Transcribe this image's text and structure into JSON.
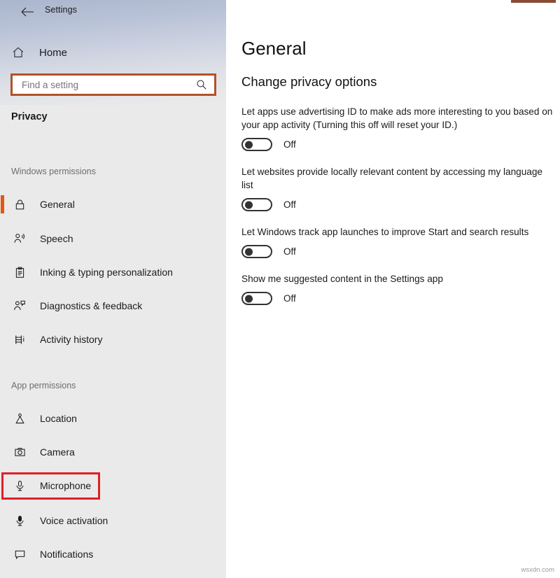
{
  "window": {
    "titlebar_label": "Settings",
    "back_icon": "back-arrow-icon"
  },
  "sidebar": {
    "home": {
      "label": "Home",
      "icon": "home-icon"
    },
    "search": {
      "value": "",
      "placeholder": "Find a setting",
      "icon": "search-icon"
    },
    "category_title": "Privacy",
    "groups": [
      {
        "heading": "Windows permissions",
        "items": [
          {
            "label": "General",
            "icon": "lock-icon",
            "selected": true
          },
          {
            "label": "Speech",
            "icon": "person-speaking-icon",
            "selected": false
          },
          {
            "label": "Inking & typing personalization",
            "icon": "clipboard-pen-icon",
            "selected": false
          },
          {
            "label": "Diagnostics & feedback",
            "icon": "person-feedback-icon",
            "selected": false
          },
          {
            "label": "Activity history",
            "icon": "timeline-icon",
            "selected": false
          }
        ]
      },
      {
        "heading": "App permissions",
        "items": [
          {
            "label": "Location",
            "icon": "location-pin-icon",
            "selected": false
          },
          {
            "label": "Camera",
            "icon": "camera-icon",
            "selected": false
          },
          {
            "label": "Microphone",
            "icon": "microphone-icon",
            "selected": false
          },
          {
            "label": "Voice activation",
            "icon": "microphone-filled-icon",
            "selected": false
          },
          {
            "label": "Notifications",
            "icon": "speech-bubble-icon",
            "selected": false
          }
        ]
      }
    ]
  },
  "main": {
    "page_title": "General",
    "section_title": "Change privacy options",
    "settings": [
      {
        "description": "Let apps use advertising ID to make ads more interesting to you based on your app activity (Turning this off will reset your ID.)",
        "state_label": "Off",
        "on": false
      },
      {
        "description": "Let websites provide locally relevant content by accessing my language list",
        "state_label": "Off",
        "on": false
      },
      {
        "description": "Let Windows track app launches to improve Start and search results",
        "state_label": "Off",
        "on": false
      },
      {
        "description": "Show me suggested content in the Settings app",
        "state_label": "Off",
        "on": false
      }
    ]
  },
  "annotations": {
    "search_box_color": "#b1522a",
    "microphone_box_color": "#e01f26",
    "selected_accent_color": "#e4560f",
    "top_accent_color": "#8a4b35"
  },
  "watermark": "wsxdn.com"
}
